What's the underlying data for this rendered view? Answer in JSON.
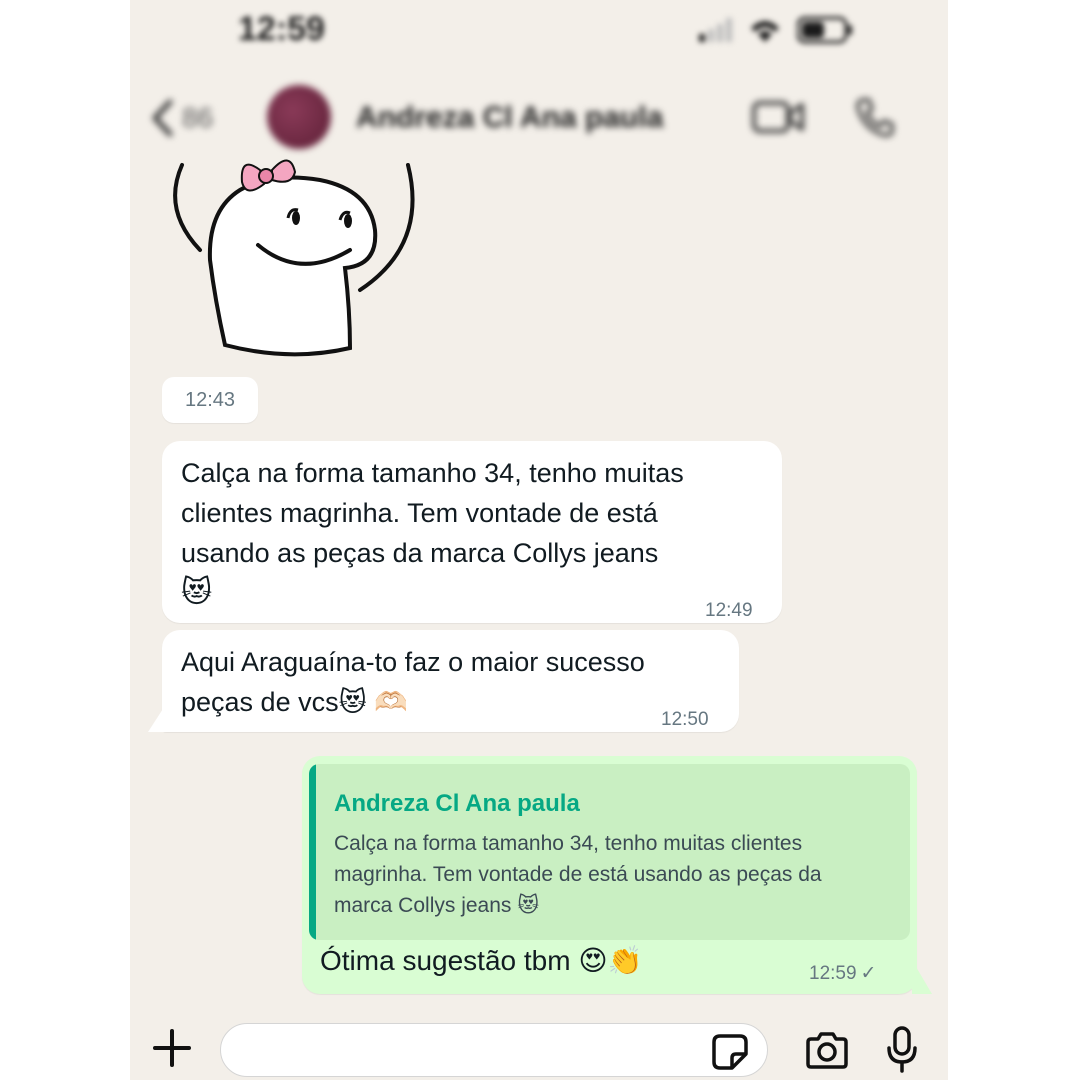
{
  "status_bar": {
    "time": "12:59"
  },
  "header": {
    "back_count": "86",
    "contact_name": "Andreza Cl Ana paula",
    "icons": [
      "chevron-left-icon",
      "video-call-icon",
      "phone-icon"
    ]
  },
  "sticker": {
    "description_icon": "flork-sticker"
  },
  "chat": {
    "sticker_time": "12:43",
    "messages_in": [
      {
        "lines": [
          "Calça na forma tamanho 34, tenho muitas",
          "clientes magrinha. Tem vontade de está",
          "usando as peças da marca Collys jeans",
          "😻"
        ],
        "time": "12:49"
      },
      {
        "lines": [
          "Aqui Araguaína-to faz o maior sucesso",
          "peças de vcs😻 🫶🏻"
        ],
        "time": "12:50"
      }
    ],
    "message_out": {
      "quote_name": "Andreza Cl Ana paula",
      "quote_lines": [
        "Calça na forma tamanho 34, tenho muitas clientes",
        "magrinha. Tem vontade de está usando as peças da",
        "marca Collys jeans 😻"
      ],
      "text": "Ótima sugestão tbm 😍👏",
      "time": "12:59",
      "status": "✓"
    }
  },
  "input_bar": {
    "placeholder": "",
    "icons": [
      "plus-icon",
      "sticker-icon",
      "camera-icon",
      "microphone-icon"
    ]
  },
  "colors": {
    "chat_background": "#f3efe9",
    "incoming_bubble": "#ffffff",
    "outgoing_bubble": "#d9fdd3",
    "quote_accent": "#06a884"
  }
}
